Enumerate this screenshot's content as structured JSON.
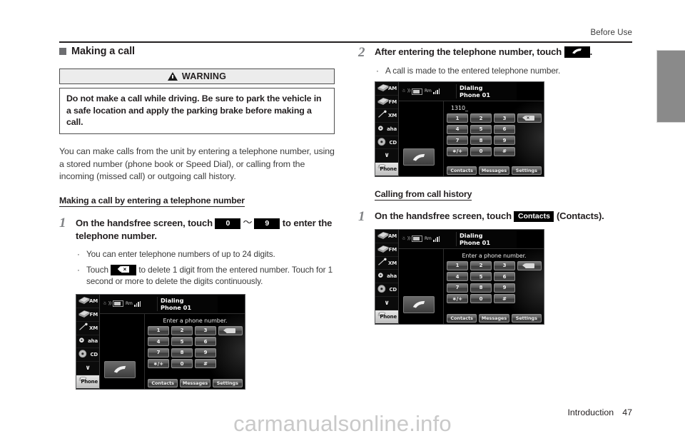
{
  "page": {
    "running_head": "Before Use",
    "footer_section": "Introduction",
    "footer_page": "47",
    "watermark": "carmanualsonline.info"
  },
  "left_column": {
    "section_heading": "Making a call",
    "warning": {
      "title": "WARNING",
      "body": "Do not make a call while driving. Be sure to park the vehicle in a safe location and apply the parking brake before making a call."
    },
    "intro_paragraph": "You can make calls from the unit by entering a telephone number, using a stored number (phone book or Speed Dial), or calling from the incoming (missed call) or outgoing call history.",
    "sub_heading": "Making a call by entering a telephone number",
    "step": {
      "number": "1",
      "text_before_key1": "On the handsfree screen, touch ",
      "key1": "0",
      "tilde": "〜",
      "key2": "9",
      "text_after_key2": " to enter the telephone number."
    },
    "bullets": [
      {
        "dot": "·",
        "text": "You can enter telephone numbers of up to 24 digits."
      },
      {
        "dot": "·",
        "text_before_key": "Touch ",
        "key": "backspace-icon",
        "text_after_key": " to delete 1 digit from the entered number. Touch for 1 second or more to delete the digits continuously."
      }
    ]
  },
  "right_column": {
    "step2": {
      "number": "2",
      "text_before_key": "After entering the telephone number, touch ",
      "key": "handset-icon",
      "text_after_key": "."
    },
    "step2_bullets": [
      {
        "dot": "·",
        "text": "A call is made to the entered telephone number."
      }
    ],
    "sub_heading": "Calling from call history",
    "step1": {
      "number": "1",
      "text_before_key": "On the handsfree screen, touch ",
      "key": "Contacts",
      "text_after_key": " (Contacts)."
    }
  },
  "head_unit": {
    "rail_items": [
      {
        "label": "AM",
        "icon": "radio-icon",
        "selected": false
      },
      {
        "label": "FM",
        "icon": "radio-icon",
        "selected": false
      },
      {
        "label": "XM",
        "icon": "satellite-icon",
        "selected": false
      },
      {
        "label": "aha",
        "icon": "aha-icon",
        "selected": false
      },
      {
        "label": "CD",
        "icon": "cd-icon",
        "selected": false
      },
      {
        "label": "∨",
        "icon": "chevron-down-icon",
        "selected": false
      },
      {
        "label": "Phone",
        "icon": "phone-icon",
        "selected": true
      }
    ],
    "status_icons": [
      "bluetooth-icon",
      "sound-icon",
      "battery-icon",
      "roaming-label",
      "signal-icon"
    ],
    "roaming_label": "Rm",
    "title_line1": "Dialing",
    "title_line2": "Phone 01",
    "prompt_empty": "Enter a phone number.",
    "prompt_dialed": "1310_",
    "keypad": [
      [
        "1",
        "2",
        "3"
      ],
      [
        "4",
        "5",
        "6"
      ],
      [
        "7",
        "8",
        "9"
      ],
      [
        "∗/+",
        "0",
        "#"
      ]
    ],
    "delete_key": "backspace-icon",
    "call_button": "handset-icon",
    "tabs": [
      "Contacts",
      "Messages",
      "Settings"
    ]
  },
  "screens": {
    "left_step1": {
      "prompt_mode": "empty"
    },
    "right_step2": {
      "prompt_mode": "dialed"
    },
    "right_history": {
      "prompt_mode": "empty"
    }
  },
  "colors": {
    "rule": "#231f20",
    "warning_bg": "#ececec",
    "thumb_tab": "#8a8a8a",
    "step_number": "#808285",
    "body_text": "#3b3b3b"
  }
}
